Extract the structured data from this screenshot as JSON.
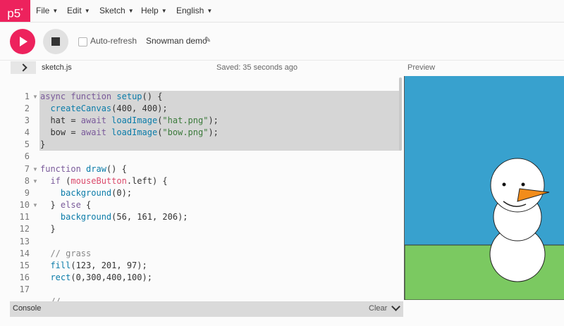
{
  "app": {
    "logo": "p5",
    "logo_sup": "*"
  },
  "menu": {
    "file": "File",
    "edit": "Edit",
    "sketch": "Sketch",
    "help": "Help",
    "language": "English"
  },
  "toolbar": {
    "autorefresh_label": "Auto-refresh",
    "autorefresh_checked": false,
    "sketch_name": "Snowman demo"
  },
  "editor": {
    "file_tab": "sketch.js",
    "saved_status": "Saved: 35 seconds ago",
    "line_numbers": [
      "1",
      "2",
      "3",
      "4",
      "5",
      "6",
      "7",
      "8",
      "9",
      "10",
      "11",
      "12",
      "13",
      "14",
      "15",
      "16",
      "17"
    ],
    "folded_lines": [
      "1",
      "7",
      "8",
      "10"
    ],
    "lines": [
      "async function setup() {",
      "  createCanvas(400, 400);",
      "  hat = await loadImage(\"hat.png\");",
      "  bow = await loadImage(\"bow.png\");",
      "}",
      "",
      "function draw() {",
      "  if (mouseButton.left) {",
      "    background(0);",
      "  } else {",
      "    background(56, 161, 206);",
      "  }",
      "",
      "  // grass",
      "  fill(123, 201, 97);",
      "  rect(0,300,400,100);",
      "",
      "  //"
    ]
  },
  "preview": {
    "title": "Preview",
    "sky_color": "#38a1ce",
    "grass_color": "#7bc961",
    "nose_color": "#f28c1a"
  },
  "console": {
    "title": "Console",
    "clear_label": "Clear"
  },
  "colors": {
    "accent": "#ed225d"
  }
}
